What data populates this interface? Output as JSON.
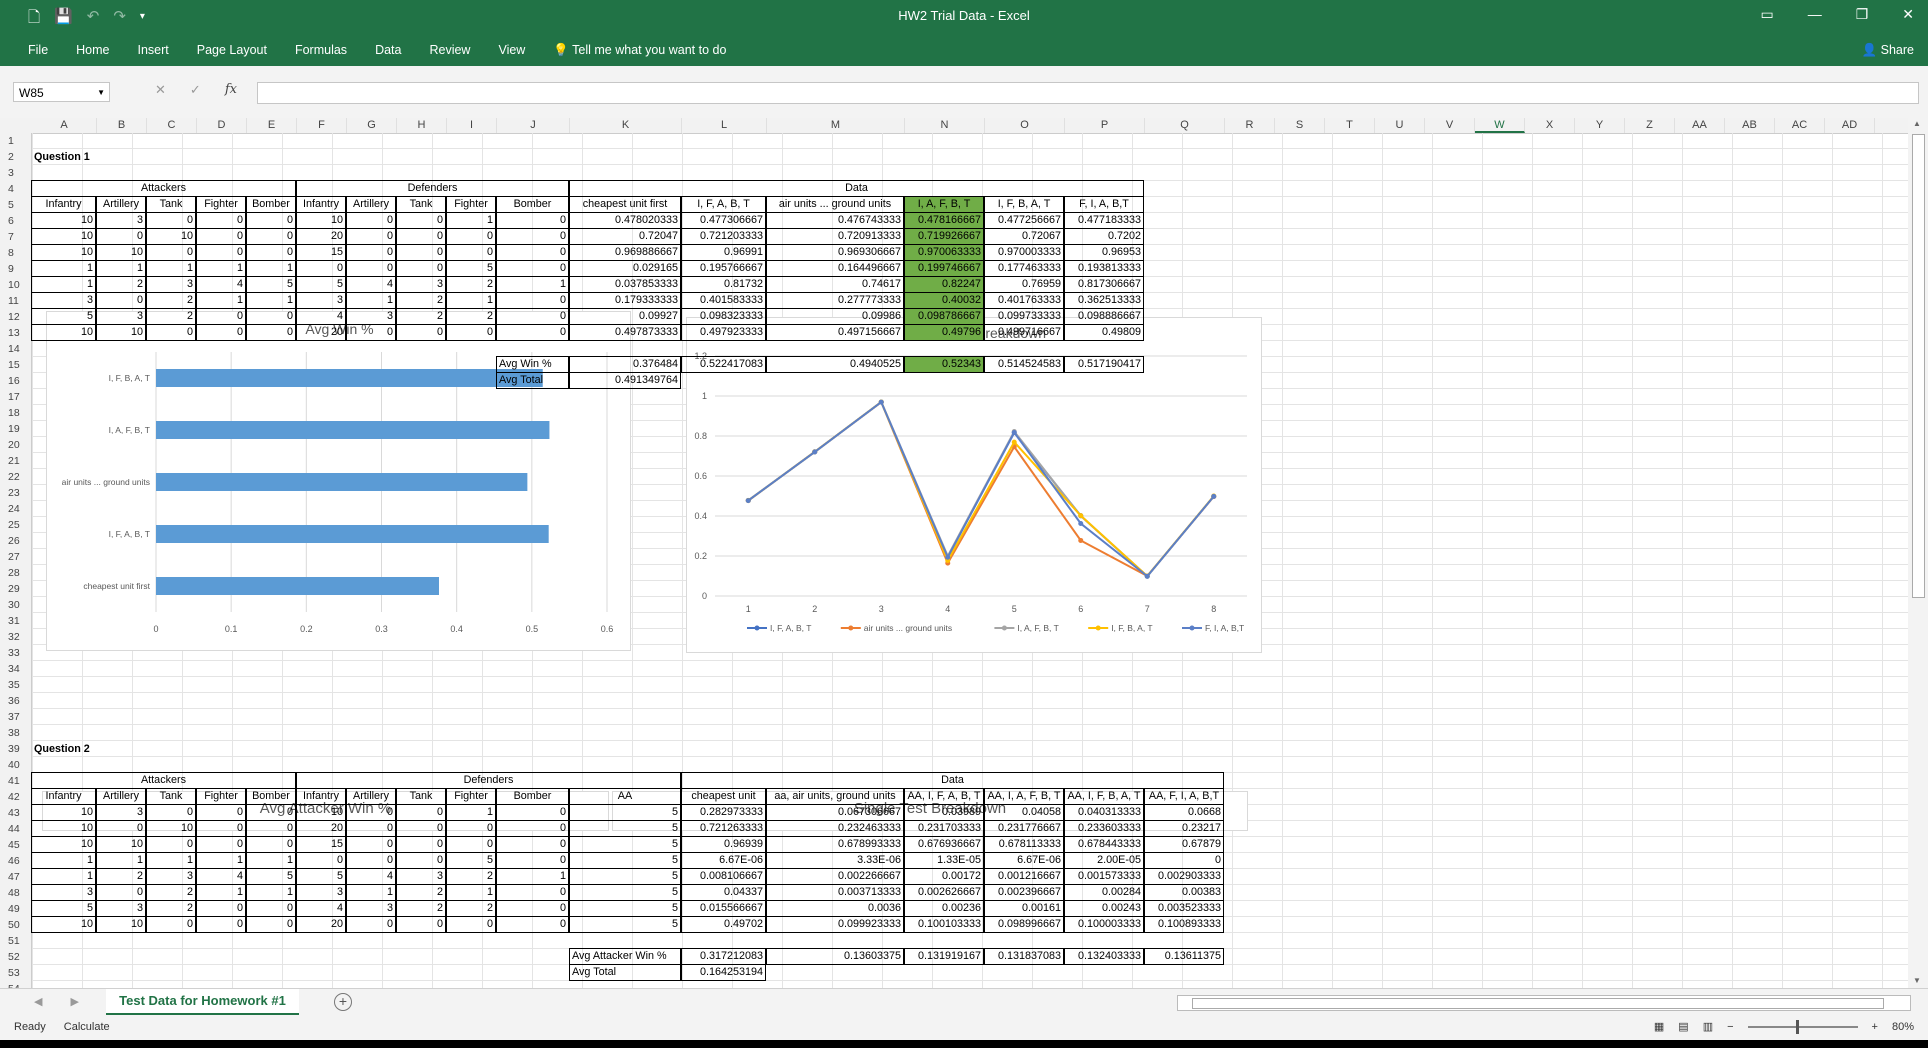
{
  "title": "HW2 Trial Data  -  Excel",
  "ribbon": {
    "tabs": [
      "File",
      "Home",
      "Insert",
      "Page Layout",
      "Formulas",
      "Data",
      "Review",
      "View"
    ],
    "tell": "Tell me what you want to do",
    "share": "Share"
  },
  "namebox": "W85",
  "columns": [
    "A",
    "B",
    "C",
    "D",
    "E",
    "F",
    "G",
    "H",
    "I",
    "J",
    "K",
    "L",
    "M",
    "N",
    "O",
    "P",
    "Q",
    "R",
    "S",
    "T",
    "U",
    "V",
    "W",
    "X",
    "Y",
    "Z",
    "AA",
    "AB",
    "AC",
    "AD"
  ],
  "selected_column": "W",
  "q1": {
    "label": "Question 1",
    "groups": [
      "Attackers",
      "Defenders",
      "Data"
    ],
    "headers": [
      "Infantry",
      "Artillery",
      "Tank",
      "Fighter",
      "Bomber",
      "Infantry",
      "Artillery",
      "Tank",
      "Fighter",
      "Bomber",
      "cheapest unit first",
      "I, F, A, B, T",
      "air units ... ground units",
      "I, A, F, B, T",
      "I, F, B, A, T",
      "F, I, A, B,T"
    ],
    "rows": [
      [
        "10",
        "3",
        "0",
        "0",
        "0",
        "10",
        "0",
        "0",
        "1",
        "0",
        "0.478020333",
        "0.477306667",
        "0.476743333",
        "0.478166667",
        "0.477256667",
        "0.477183333"
      ],
      [
        "10",
        "0",
        "10",
        "0",
        "0",
        "20",
        "0",
        "0",
        "0",
        "0",
        "0.72047",
        "0.721203333",
        "0.720913333",
        "0.719926667",
        "0.72067",
        "0.7202"
      ],
      [
        "10",
        "10",
        "0",
        "0",
        "0",
        "15",
        "0",
        "0",
        "0",
        "0",
        "0.969886667",
        "0.96991",
        "0.969306667",
        "0.970063333",
        "0.970003333",
        "0.96953"
      ],
      [
        "1",
        "1",
        "1",
        "1",
        "1",
        "0",
        "0",
        "0",
        "5",
        "0",
        "0.029165",
        "0.195766667",
        "0.164496667",
        "0.199746667",
        "0.177463333",
        "0.193813333"
      ],
      [
        "1",
        "2",
        "3",
        "4",
        "5",
        "5",
        "4",
        "3",
        "2",
        "1",
        "0.037853333",
        "0.81732",
        "0.74617",
        "0.82247",
        "0.76959",
        "0.817306667"
      ],
      [
        "3",
        "0",
        "2",
        "1",
        "1",
        "3",
        "1",
        "2",
        "1",
        "0",
        "0.179333333",
        "0.401583333",
        "0.277773333",
        "0.40032",
        "0.401763333",
        "0.362513333"
      ],
      [
        "5",
        "3",
        "2",
        "0",
        "0",
        "4",
        "3",
        "2",
        "2",
        "0",
        "0.09927",
        "0.098323333",
        "0.09986",
        "0.098786667",
        "0.099733333",
        "0.098886667"
      ],
      [
        "10",
        "10",
        "0",
        "0",
        "0",
        "20",
        "0",
        "0",
        "0",
        "0",
        "0.497873333",
        "0.497923333",
        "0.497156667",
        "0.49796",
        "0.499716667",
        "0.49809"
      ]
    ],
    "avg_win_label": "Avg Win %",
    "avg_win": [
      "0.376484",
      "0.522417083",
      "0.4940525",
      "0.52343",
      "0.514524583",
      "0.517190417"
    ],
    "avg_total_label": "Avg Total",
    "avg_total": "0.491349764"
  },
  "q2": {
    "label": "Question 2",
    "groups": [
      "Attackers",
      "Defenders",
      "Data"
    ],
    "headers": [
      "Infantry",
      "Artillery",
      "Tank",
      "Fighter",
      "Bomber",
      "Infantry",
      "Artillery",
      "Tank",
      "Fighter",
      "Bomber",
      "AA",
      "cheapest unit",
      "aa, air units, ground units",
      "AA, I, F, A, B, T",
      "AA, I, A, F, B, T",
      "AA, I, F, B, A, T",
      "AA, F, I, A, B,T"
    ],
    "rows": [
      [
        "10",
        "3",
        "0",
        "0",
        "0",
        "10",
        "0",
        "0",
        "1",
        "0",
        "5",
        "0.282973333",
        "0.067306667",
        "0.03989",
        "0.04058",
        "0.040313333",
        "0.0668"
      ],
      [
        "10",
        "0",
        "10",
        "0",
        "0",
        "20",
        "0",
        "0",
        "0",
        "0",
        "5",
        "0.721263333",
        "0.232463333",
        "0.231703333",
        "0.231776667",
        "0.233603333",
        "0.23217"
      ],
      [
        "10",
        "10",
        "0",
        "0",
        "0",
        "15",
        "0",
        "0",
        "0",
        "0",
        "5",
        "0.96939",
        "0.678993333",
        "0.676936667",
        "0.678113333",
        "0.678443333",
        "0.67879"
      ],
      [
        "1",
        "1",
        "1",
        "1",
        "1",
        "0",
        "0",
        "0",
        "5",
        "0",
        "5",
        "6.67E-06",
        "3.33E-06",
        "1.33E-05",
        "6.67E-06",
        "2.00E-05",
        "0"
      ],
      [
        "1",
        "2",
        "3",
        "4",
        "5",
        "5",
        "4",
        "3",
        "2",
        "1",
        "5",
        "0.008106667",
        "0.002266667",
        "0.00172",
        "0.001216667",
        "0.001573333",
        "0.002903333"
      ],
      [
        "3",
        "0",
        "2",
        "1",
        "1",
        "3",
        "1",
        "2",
        "1",
        "0",
        "5",
        "0.04337",
        "0.003713333",
        "0.002626667",
        "0.002396667",
        "0.00284",
        "0.00383"
      ],
      [
        "5",
        "3",
        "2",
        "0",
        "0",
        "4",
        "3",
        "2",
        "2",
        "0",
        "5",
        "0.015566667",
        "0.0036",
        "0.00236",
        "0.00161",
        "0.00243",
        "0.003523333"
      ],
      [
        "10",
        "10",
        "0",
        "0",
        "0",
        "20",
        "0",
        "0",
        "0",
        "0",
        "5",
        "0.49702",
        "0.099923333",
        "0.100103333",
        "0.098996667",
        "0.100003333",
        "0.100893333"
      ]
    ],
    "avg_win_label": "Avg Attacker Win %",
    "avg_win": [
      "0.317212083",
      "0.13603375",
      "0.131919167",
      "0.131837083",
      "0.132403333",
      "0.13611375"
    ],
    "avg_total_label": "Avg Total",
    "avg_total": "0.164253194"
  },
  "chart_data": [
    {
      "type": "bar",
      "title": "Avg Win %",
      "categories": [
        "I, F, B, A, T",
        "I, A, F, B, T",
        "air units ... ground units",
        "I, F, A, B, T",
        "cheapest unit first"
      ],
      "values": [
        0.514524583,
        0.52343,
        0.4940525,
        0.522417083,
        0.376484
      ],
      "xlim": [
        0,
        0.6
      ],
      "xticks": [
        "0",
        "0.1",
        "0.2",
        "0.3",
        "0.4",
        "0.5",
        "0.6"
      ],
      "color": "#5b9bd5"
    },
    {
      "type": "line",
      "title": "Single Test Breakdown",
      "x": [
        1,
        2,
        3,
        4,
        5,
        6,
        7,
        8
      ],
      "ylim": [
        0,
        1.2
      ],
      "yticks": [
        "1.2",
        "1",
        "0.8",
        "0.6",
        "0.4",
        "0.2",
        "0"
      ],
      "series": [
        {
          "name": "I, F, A, B, T",
          "color": "#4472c4",
          "values": [
            0.477306667,
            0.721203333,
            0.96991,
            0.195766667,
            0.81732,
            0.401583333,
            0.098323333,
            0.497923333
          ]
        },
        {
          "name": "air units ... ground units",
          "color": "#ed7d31",
          "values": [
            0.476743333,
            0.720913333,
            0.969306667,
            0.164496667,
            0.74617,
            0.277773333,
            0.09986,
            0.497156667
          ]
        },
        {
          "name": "I, A, F, B, T",
          "color": "#a5a5a5",
          "values": [
            0.478166667,
            0.719926667,
            0.970063333,
            0.199746667,
            0.82247,
            0.40032,
            0.098786667,
            0.49796
          ]
        },
        {
          "name": "I, F, B, A, T",
          "color": "#ffc000",
          "values": [
            0.477256667,
            0.72067,
            0.970003333,
            0.177463333,
            0.76959,
            0.401763333,
            0.099733333,
            0.499716667
          ]
        },
        {
          "name": "F, I, A, B,T",
          "color": "#5b7fc7",
          "values": [
            0.477183333,
            0.7202,
            0.96953,
            0.193813333,
            0.817306667,
            0.362513333,
            0.098886667,
            0.49809
          ]
        }
      ]
    }
  ],
  "partial_charts": [
    "Avg Attacker Win %",
    "Single Test Breakdown"
  ],
  "sheet_tab": "Test Data for Homework #1",
  "status": {
    "ready": "Ready",
    "calculate": "Calculate",
    "zoom": "80%"
  }
}
